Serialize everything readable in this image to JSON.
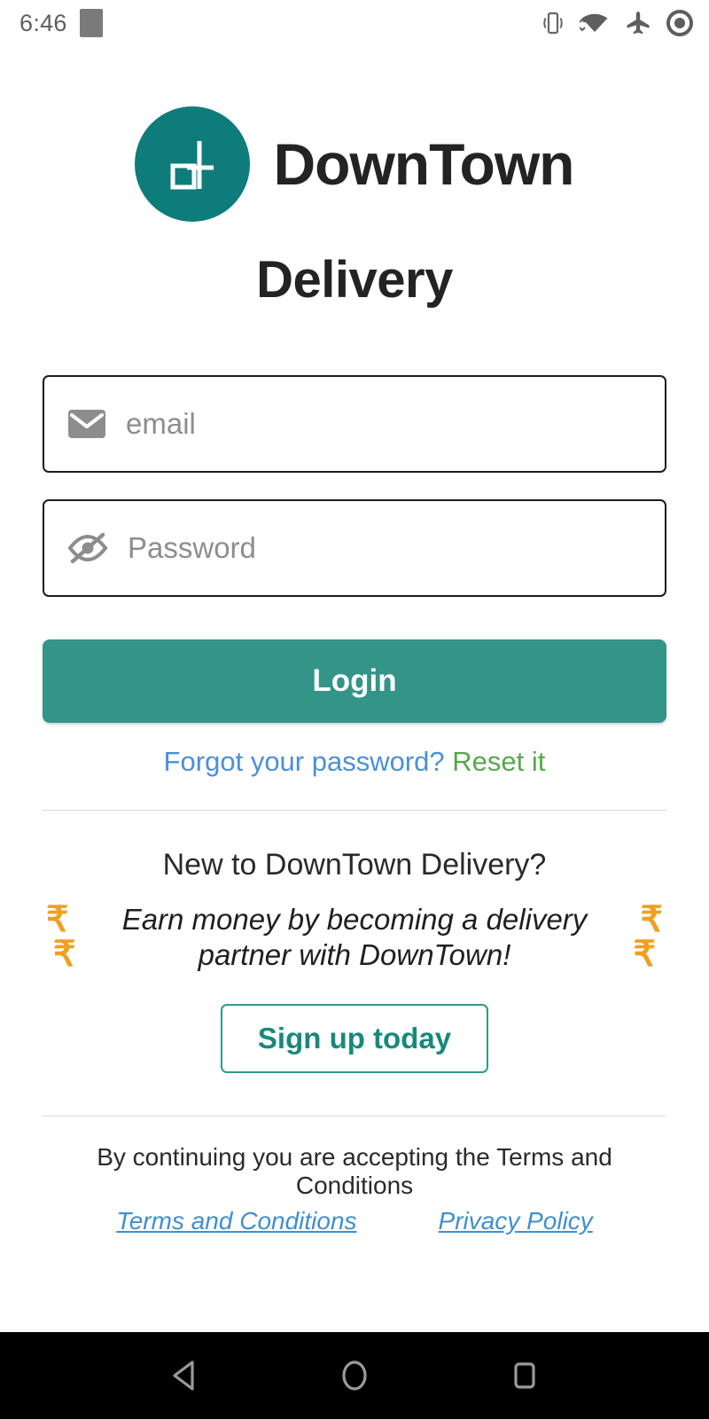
{
  "status_bar": {
    "time": "6:46",
    "icons": [
      "notification-block",
      "vibrate-icon",
      "wifi-icon",
      "airplane-mode-icon",
      "record-dot-icon"
    ]
  },
  "brand": {
    "logo_icon": "downtown-dt-monogram",
    "name": "DownTown",
    "subtitle": "Delivery",
    "logo_bg_color": "#0e7c7b"
  },
  "form": {
    "email": {
      "icon": "envelope-icon",
      "placeholder": "email",
      "value": ""
    },
    "password": {
      "icon": "eye-off-icon",
      "placeholder": "Password",
      "value": ""
    },
    "login_label": "Login",
    "login_color": "#339488"
  },
  "forgot": {
    "question": "Forgot your password?",
    "action": "Reset it",
    "question_color": "#4a90d9",
    "action_color": "#56a84b"
  },
  "promo": {
    "title": "New to DownTown Delivery?",
    "message_line1": "Earn money by becoming a delivery",
    "message_line2": "partner with DownTown!",
    "rupee_symbol": "₹",
    "rupee_color": "#f0a020",
    "signup_label": "Sign up today",
    "signup_color": "#17897c"
  },
  "footer": {
    "notice": "By continuing you are accepting the Terms and Conditions",
    "terms_label": "Terms and Conditions",
    "privacy_label": "Privacy Policy",
    "link_color": "#3f8fd0"
  },
  "navigation": {
    "back_icon": "back-triangle-icon",
    "home_icon": "home-circle-icon",
    "recents_icon": "recents-square-icon"
  }
}
